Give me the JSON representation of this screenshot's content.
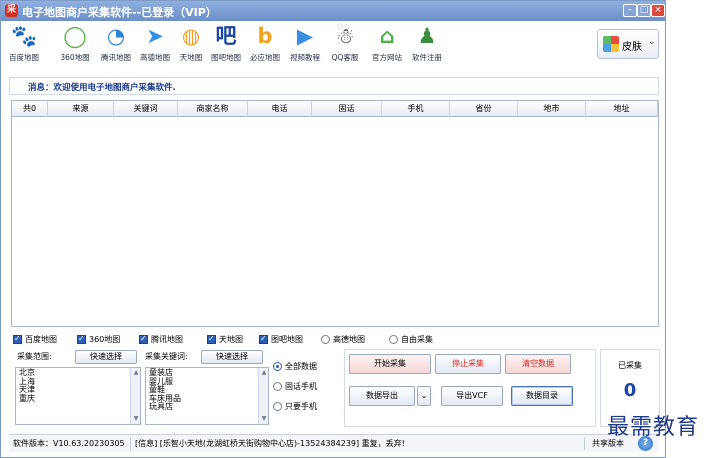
{
  "window": {
    "title": "电子地图商户采集软件--已登录（VIP）",
    "app_icon_glyph": "采",
    "controls": {
      "minimize": "–",
      "maximize": "□",
      "close": "×"
    }
  },
  "toolbar": {
    "items": [
      {
        "label": "百度地图",
        "icon": "baidu-paw-icon",
        "glyph": "🐾",
        "color": "#2e67d2"
      },
      {
        "label": "360地图",
        "icon": "360-ring-icon",
        "glyph": "◯",
        "color": "#5ab04a"
      },
      {
        "label": "腾讯地图",
        "icon": "tencent-map-icon",
        "glyph": "◔",
        "color": "#2a83dd"
      },
      {
        "label": "高德地图",
        "icon": "amap-arrow-icon",
        "glyph": "➤",
        "color": "#2f8fe6"
      },
      {
        "label": "天地图",
        "icon": "globe-icon",
        "glyph": "◍",
        "color": "#f0a12a"
      },
      {
        "label": "图吧地图",
        "icon": "mapbar-icon",
        "glyph": "吧",
        "color": "#1d47a0"
      },
      {
        "label": "必应地图",
        "icon": "bing-icon",
        "glyph": "b",
        "color": "#f3a21f"
      },
      {
        "label": "视频教程",
        "icon": "video-play-icon",
        "glyph": "▶",
        "color": "#3c8ee3"
      },
      {
        "label": "QQ客服",
        "icon": "qq-penguin-icon",
        "glyph": "☃",
        "color": "#222222"
      },
      {
        "label": "官方网站",
        "icon": "home-icon",
        "glyph": "⌂",
        "color": "#4fb14a"
      },
      {
        "label": "软件注册",
        "icon": "user-register-icon",
        "glyph": "♟",
        "color": "#3b8e3f"
      }
    ],
    "skin_label": "皮肤",
    "skin_arrow": "⌄"
  },
  "message": {
    "text": "消息：欢迎使用电子地图商户采集软件."
  },
  "table": {
    "columns": [
      "共0",
      "来源",
      "关键词",
      "商家名称",
      "电话",
      "固话",
      "手机",
      "省份",
      "地市",
      "地址"
    ],
    "rows": []
  },
  "sources": [
    {
      "label": "百度地图",
      "checked": true,
      "type": "check"
    },
    {
      "label": "360地图",
      "checked": true,
      "type": "check"
    },
    {
      "label": "腾讯地图",
      "checked": true,
      "type": "check"
    },
    {
      "label": "天地图",
      "checked": true,
      "type": "check"
    },
    {
      "label": "图吧地图",
      "checked": true,
      "type": "check"
    },
    {
      "label": "高德地图",
      "checked": false,
      "type": "radio"
    },
    {
      "label": "自由采集",
      "checked": false,
      "type": "radio"
    }
  ],
  "range": {
    "label": "采集范围:",
    "quick_select": "快速选择",
    "items": [
      "北京",
      "上海",
      "天津",
      "重庆"
    ]
  },
  "keywords": {
    "label": "采集关键词:",
    "quick_select": "快速选择",
    "items": [
      "童装店",
      "婴儿服",
      "童鞋",
      "车床用品",
      "玩具店"
    ]
  },
  "filter": {
    "options": [
      {
        "label": "全部数据",
        "selected": true
      },
      {
        "label": "固话手机",
        "selected": false
      },
      {
        "label": "只要手机",
        "selected": false
      }
    ]
  },
  "actions": {
    "start": "开始采集",
    "stop": "停止采集",
    "clear": "清空数据",
    "export": "数据导出",
    "export_arrow": "⌄",
    "export_vcf": "导出VCF",
    "data_dir": "数据目录"
  },
  "collected": {
    "label": "已采集",
    "count": "0"
  },
  "status": {
    "version": "软件版本：V10.63.20230305",
    "info": "[信息] [乐智小天地(龙湖虹桥天街购物中心店)-13524384239] 重复，丢弃!",
    "share": "共享版本",
    "help_glyph": "?"
  },
  "watermark": "最需教育"
}
